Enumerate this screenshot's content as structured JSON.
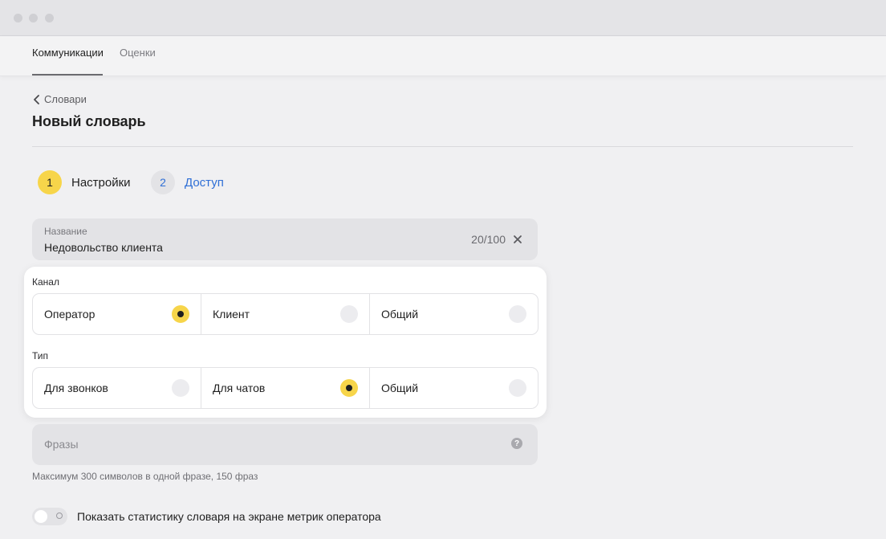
{
  "nav": {
    "tabs": [
      {
        "label": "Коммуникации",
        "active": true
      },
      {
        "label": "Оценки",
        "active": false
      }
    ]
  },
  "breadcrumb": {
    "back_label": "Словари",
    "icon": "chevron-left-icon"
  },
  "page": {
    "title": "Новый словарь"
  },
  "steps": [
    {
      "number": "1",
      "label": "Настройки",
      "active": true
    },
    {
      "number": "2",
      "label": "Доступ",
      "active": false
    }
  ],
  "name_field": {
    "label": "Название",
    "value": "Недовольство клиента",
    "counter": "20/100",
    "clear_icon": "close-icon"
  },
  "channel": {
    "label": "Канал",
    "options": [
      {
        "label": "Оператор",
        "selected": true
      },
      {
        "label": "Клиент",
        "selected": false
      },
      {
        "label": "Общий",
        "selected": false
      }
    ]
  },
  "type": {
    "label": "Тип",
    "options": [
      {
        "label": "Для звонков",
        "selected": false
      },
      {
        "label": "Для чатов",
        "selected": true
      },
      {
        "label": "Общий",
        "selected": false
      }
    ]
  },
  "phrases": {
    "placeholder": "Фразы",
    "help_icon": "help-icon",
    "hint": "Максимум 300 символов в одной фразе, 150 фраз"
  },
  "toggle": {
    "label": "Показать статистику словаря на экране метрик оператора",
    "enabled": false
  },
  "colors": {
    "accent_yellow": "#f7d54a",
    "link_blue": "#2f6fd6",
    "background": "#f0f0f2"
  }
}
